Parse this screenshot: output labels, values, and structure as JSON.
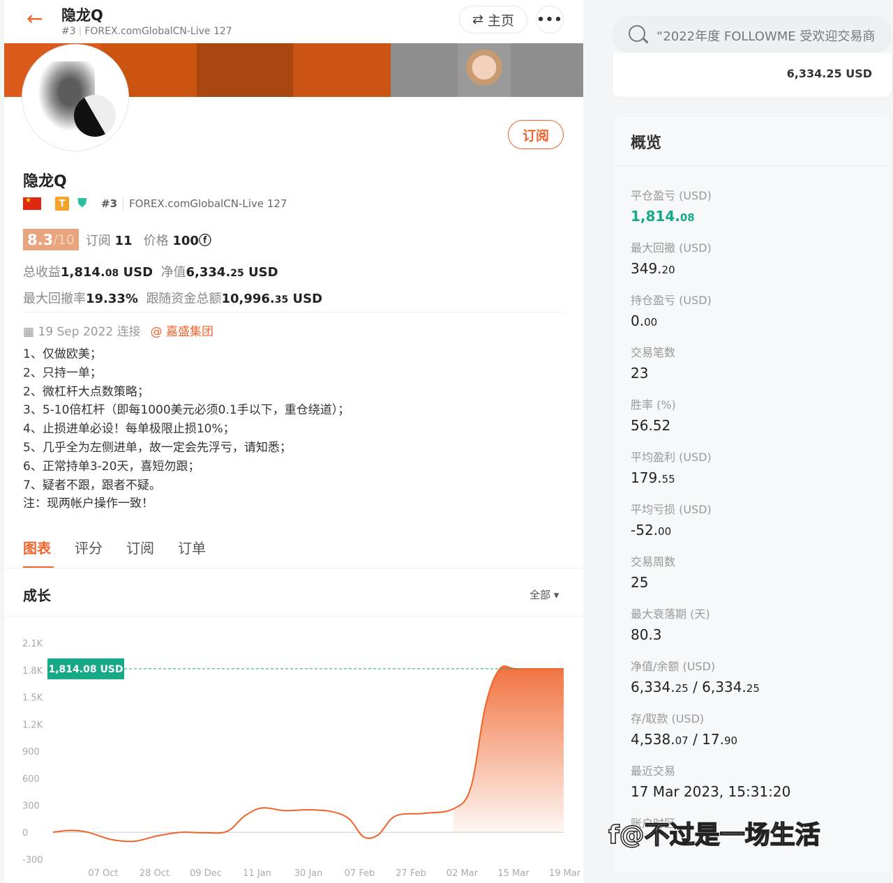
{
  "header": {
    "title": "隐龙Q",
    "rank": "#3",
    "server": "FOREX.comGlobalCN-Live 127",
    "home_label": "主页",
    "more_label": "•••"
  },
  "profile": {
    "name": "隐龙Q",
    "badge_t": "T",
    "rank": "#3",
    "server": "FOREX.comGlobalCN-Live 127",
    "subscribe_label": "订阅",
    "score": "8.3",
    "score_den": "/10",
    "subs_label": "订阅",
    "subs_value": "11",
    "price_label": "价格",
    "price_value": "100",
    "price_icon": "coin-icon",
    "total_label": "总收益",
    "total_main": "1,814.",
    "total_dec": "08",
    "total_unit": " USD",
    "equity_label": "净值",
    "equity_main": "6,334.",
    "equity_dec": "25",
    "equity_unit": " USD",
    "dd_label": "最大回撤率",
    "dd_value": "19.33%",
    "follow_label": "跟随资金总额",
    "follow_main": "10,996.",
    "follow_dec": "35",
    "follow_unit": " USD",
    "connect_date": "19 Sep 2022 连接",
    "org": "@ 嘉盛集团"
  },
  "description": [
    "1、仅做欧美；",
    "2、只持一单；",
    "2、微杠杆大点数策略；",
    "3、5-10倍杠杆（即每1000美元必须0.1手以下，重仓绕道）；",
    "4、止损进单必设！每单极限止损10%；",
    "5、几乎全为左侧进单，故一定会先浮亏，请知悉；",
    "6、正常持单3-20天，喜短勿跟；",
    "7、疑者不跟，跟者不疑。",
    "注：现两帐户操作一致！"
  ],
  "tabs": [
    "图表",
    "评分",
    "订阅",
    "订单"
  ],
  "chart_section": {
    "title": "成长",
    "range_label": "全部 ▾"
  },
  "chart_data": {
    "type": "area",
    "current_label": "1,814.08 USD",
    "current_value": 1814.08,
    "ylim": [
      -300,
      2100
    ],
    "yticks": [
      "2.1K",
      "1.8K",
      "1.5K",
      "1.2K",
      "900",
      "600",
      "300",
      "0",
      "-300"
    ],
    "xticks": [
      "07 Oct",
      "28 Oct",
      "09 Dec",
      "11 Jan",
      "30 Jan",
      "07 Feb",
      "27 Feb",
      "02 Mar",
      "15 Mar",
      "19 Mar"
    ],
    "points": [
      [
        0,
        0
      ],
      [
        0.3,
        20
      ],
      [
        0.6,
        0
      ],
      [
        1.0,
        -80
      ],
      [
        1.4,
        -100
      ],
      [
        1.8,
        -40
      ],
      [
        2.2,
        0
      ],
      [
        2.6,
        -5
      ],
      [
        3.0,
        10
      ],
      [
        3.3,
        180
      ],
      [
        3.6,
        270
      ],
      [
        4.0,
        240
      ],
      [
        4.4,
        250
      ],
      [
        4.8,
        230
      ],
      [
        5.1,
        150
      ],
      [
        5.35,
        -50
      ],
      [
        5.6,
        -30
      ],
      [
        5.9,
        180
      ],
      [
        6.4,
        210
      ],
      [
        6.9,
        260
      ],
      [
        7.2,
        500
      ],
      [
        7.45,
        1400
      ],
      [
        7.7,
        1814
      ],
      [
        8.0,
        1814
      ],
      [
        8.8,
        1814
      ]
    ],
    "line_color": "#f0632a",
    "label_color": "#17a887"
  },
  "search": {
    "placeholder": "“2022年度 FOLLOWME 受欢迎交易商"
  },
  "top_card_value": "6,334.25 USD",
  "overview": {
    "title": "概览",
    "items": [
      {
        "label": "平仓盈亏 (USD)",
        "main": "1,814.",
        "dec": "08"
      },
      {
        "label": "最大回撤 (USD)",
        "main": "349.",
        "dec": "20"
      },
      {
        "label": "持仓盈亏 (USD)",
        "main": "0.",
        "dec": "00"
      },
      {
        "label": "交易笔数",
        "main": "23",
        "dec": ""
      },
      {
        "label": "胜率 (%)",
        "main": "56.52",
        "dec": ""
      },
      {
        "label": "平均盈利 (USD)",
        "main": "179.",
        "dec": "55"
      },
      {
        "label": "平均亏损 (USD)",
        "main": "-52.",
        "dec": "00"
      },
      {
        "label": "交易周数",
        "main": "25",
        "dec": ""
      },
      {
        "label": "最大衰落期 (天)",
        "main": "80.3",
        "dec": ""
      },
      {
        "label": "净值/余额 (USD)",
        "main": "6,334.",
        "dec": "25",
        "main2": " / 6,334.",
        "dec2": "25"
      },
      {
        "label": "存/取款 (USD)",
        "main": "4,538.",
        "dec": "07",
        "main2": " / 17.",
        "dec2": "90"
      },
      {
        "label": "最近交易",
        "main": "17 Mar 2023, 15:31:20",
        "dec": ""
      },
      {
        "label": "账户时区",
        "main": "",
        "dec": ""
      }
    ]
  },
  "watermark": "f@不过是一场生活"
}
